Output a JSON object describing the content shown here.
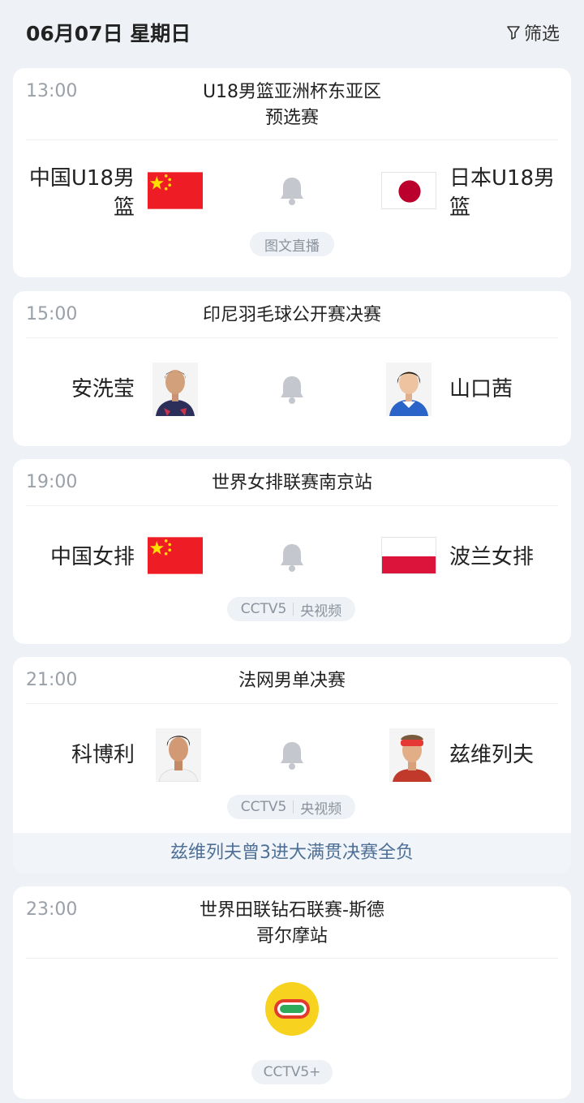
{
  "header": {
    "date": "06月07日 星期日",
    "filter_label": "筛选"
  },
  "matches": [
    {
      "time": "13:00",
      "title_line1": "U18男篮亚洲杯东亚区",
      "title_line2": "预选赛",
      "home_line1": "中国U18男",
      "home_line2": "篮",
      "home_flag": "china-flag",
      "away_line1": "日本U18男",
      "away_line2": "篮",
      "away_flag": "japan-flag",
      "broadcast": "图文直播"
    },
    {
      "time": "15:00",
      "title": "印尼羽毛球公开赛决赛",
      "home": "安洗莹",
      "away": "山口茜"
    },
    {
      "time": "19:00",
      "title": "世界女排联赛南京站",
      "home": "中国女排",
      "home_flag": "china-flag",
      "away": "波兰女排",
      "away_flag": "poland-flag",
      "broadcast": [
        "CCTV5",
        "央视频"
      ]
    },
    {
      "time": "21:00",
      "title": "法网男单决赛",
      "home": "科博利",
      "away": "兹维列夫",
      "broadcast": [
        "CCTV5",
        "央视频"
      ],
      "note": "兹维列夫曾3进大满贯决赛全负"
    },
    {
      "time": "23:00",
      "title_line1": "世界田联钻石联赛-斯德",
      "title_line2": "哥尔摩站",
      "icon": "athletics-track-icon",
      "broadcast": "CCTV5+"
    }
  ],
  "colors": {
    "background": "#eef1f5",
    "card": "#ffffff",
    "time": "#9aa0a8",
    "note_text": "#4e7096",
    "china_red": "#ee1c25",
    "china_yellow": "#ffde00",
    "japan_red": "#bc002d",
    "poland_red": "#dc143c"
  }
}
